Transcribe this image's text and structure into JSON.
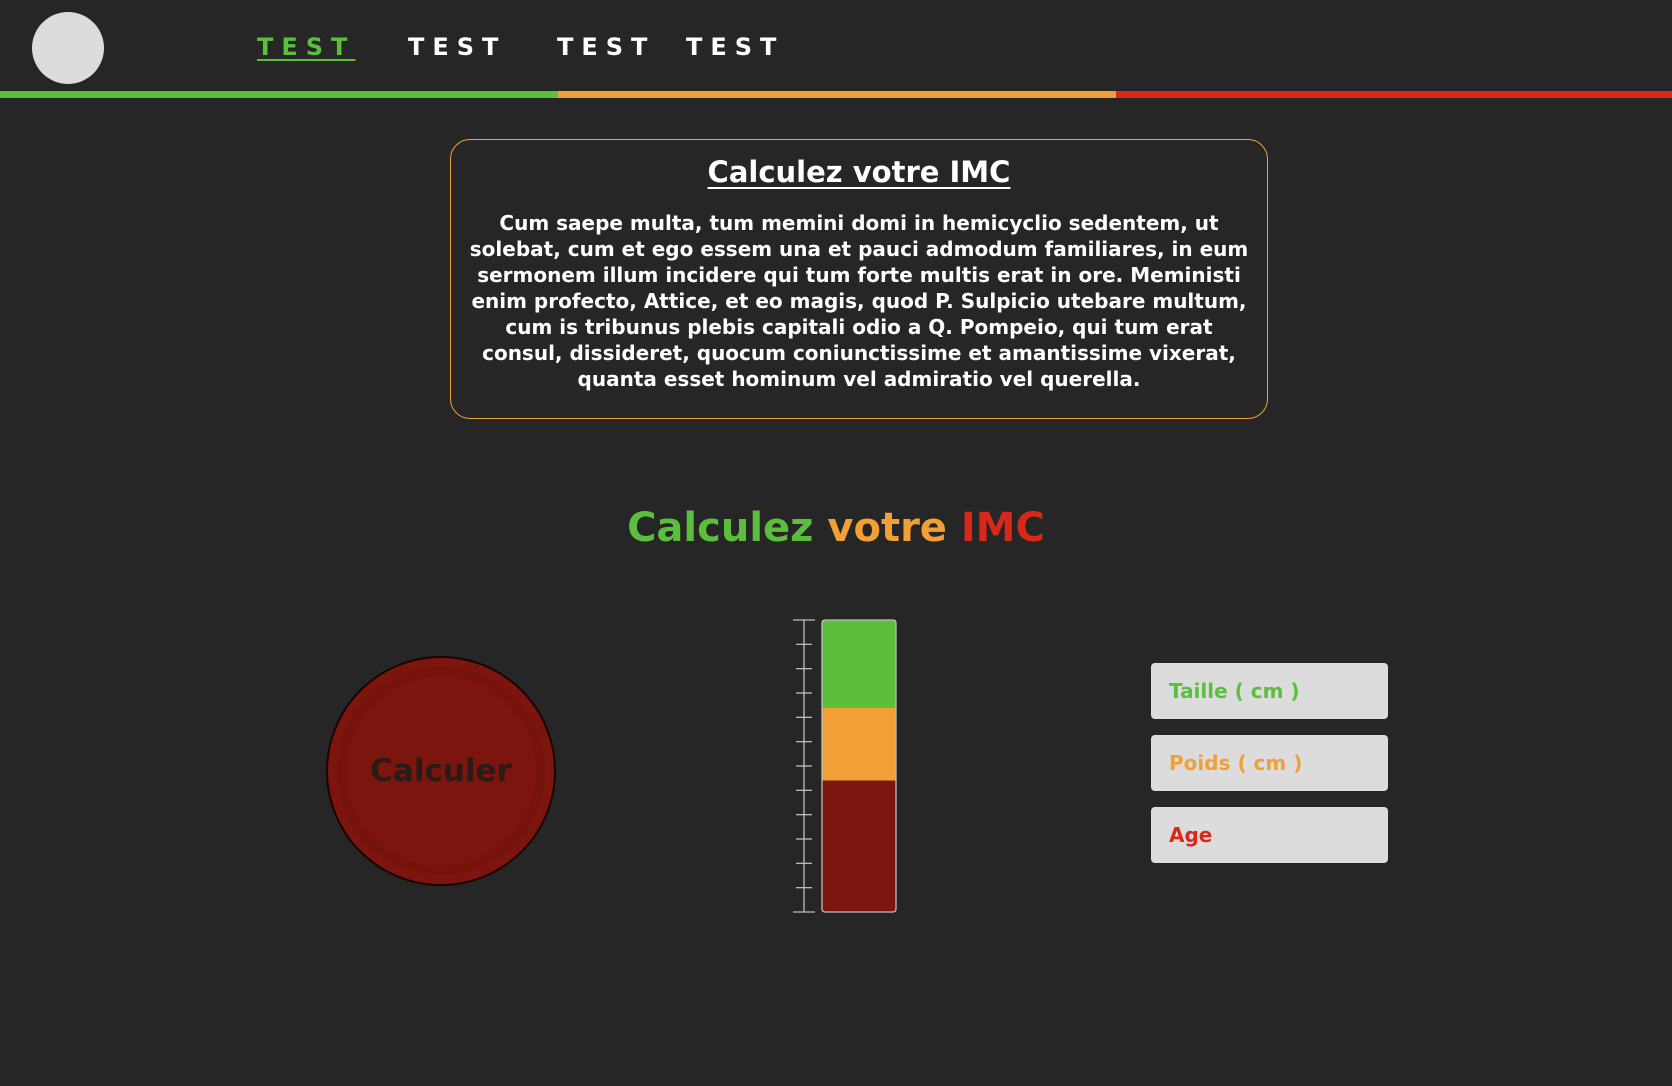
{
  "colors": {
    "green": "#5bbf3b",
    "orange": "#f0a035",
    "red": "#d9271a",
    "dark_red": "#7b150e",
    "background": "#262626"
  },
  "header": {
    "logo": "avatar-circle",
    "nav": [
      {
        "label": "TEST",
        "active": true
      },
      {
        "label": "TEST",
        "active": false
      },
      {
        "label": "TEST",
        "active": false
      },
      {
        "label": "TEST",
        "active": false
      }
    ]
  },
  "info": {
    "title": "Calculez votre IMC",
    "text": "Cum saepe multa, tum memini domi in hemicyclio sedentem, ut solebat, cum et ego essem una et pauci admodum familiares, in eum sermonem illum incidere qui tum forte multis erat in ore. Meministi enim profecto, Attice, et eo magis, quod P. Sulpicio utebare multum, cum is tribunus plebis capitali odio a Q. Pompeio, qui tum erat consul, dissideret, quocum coniunctissime et amantissime vixerat, quanta esset hominum vel admiratio vel querella."
  },
  "calculator": {
    "title_parts": [
      "Calculez",
      "votre",
      "IMC"
    ],
    "button_label": "Calculer",
    "gauge": {
      "tick_count": 13,
      "segments": [
        {
          "color": "#5bbf3b",
          "fraction": 0.3
        },
        {
          "color": "#f0a035",
          "fraction": 0.25
        },
        {
          "color": "#7b150e",
          "fraction": 0.45
        }
      ]
    },
    "fields": [
      {
        "placeholder": "Taille ( cm )",
        "color": "#5bbf3b"
      },
      {
        "placeholder": "Poids ( cm )",
        "color": "#f0a035"
      },
      {
        "placeholder": "Age",
        "color": "#d9271a"
      }
    ]
  }
}
